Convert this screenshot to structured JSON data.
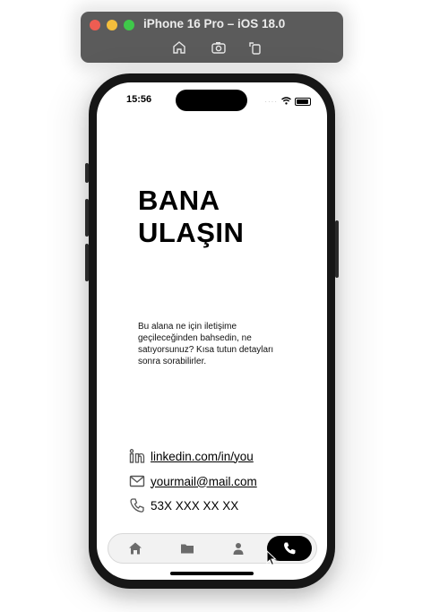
{
  "simulator": {
    "title": "iPhone 16 Pro – iOS 18.0",
    "tools": [
      "home-icon",
      "screenshot-icon",
      "rotate-icon"
    ]
  },
  "status_bar": {
    "time": "15:56"
  },
  "page": {
    "heading_line1": "BANA",
    "heading_line2": "ULAŞIN",
    "description": "Bu alana ne için iletişime geçileceğinden bahsedin, ne satıyorsunuz? Kısa tutun detayları sonra sorabilirler."
  },
  "contacts": [
    {
      "icon": "linkedin-icon",
      "text": "linkedin.com/in/you"
    },
    {
      "icon": "mail-icon",
      "text": "yourmail@mail.com"
    },
    {
      "icon": "phone-icon",
      "text": "53X XXX XX XX"
    }
  ],
  "tabbar": {
    "tabs": [
      "home-icon",
      "folder-icon",
      "person-icon",
      "phone-icon"
    ],
    "active": "phone-icon"
  },
  "colors": {
    "accent": "#000000",
    "tabbar_bg": "#f2f2f2",
    "sim_bar": "#5b5b5b"
  }
}
